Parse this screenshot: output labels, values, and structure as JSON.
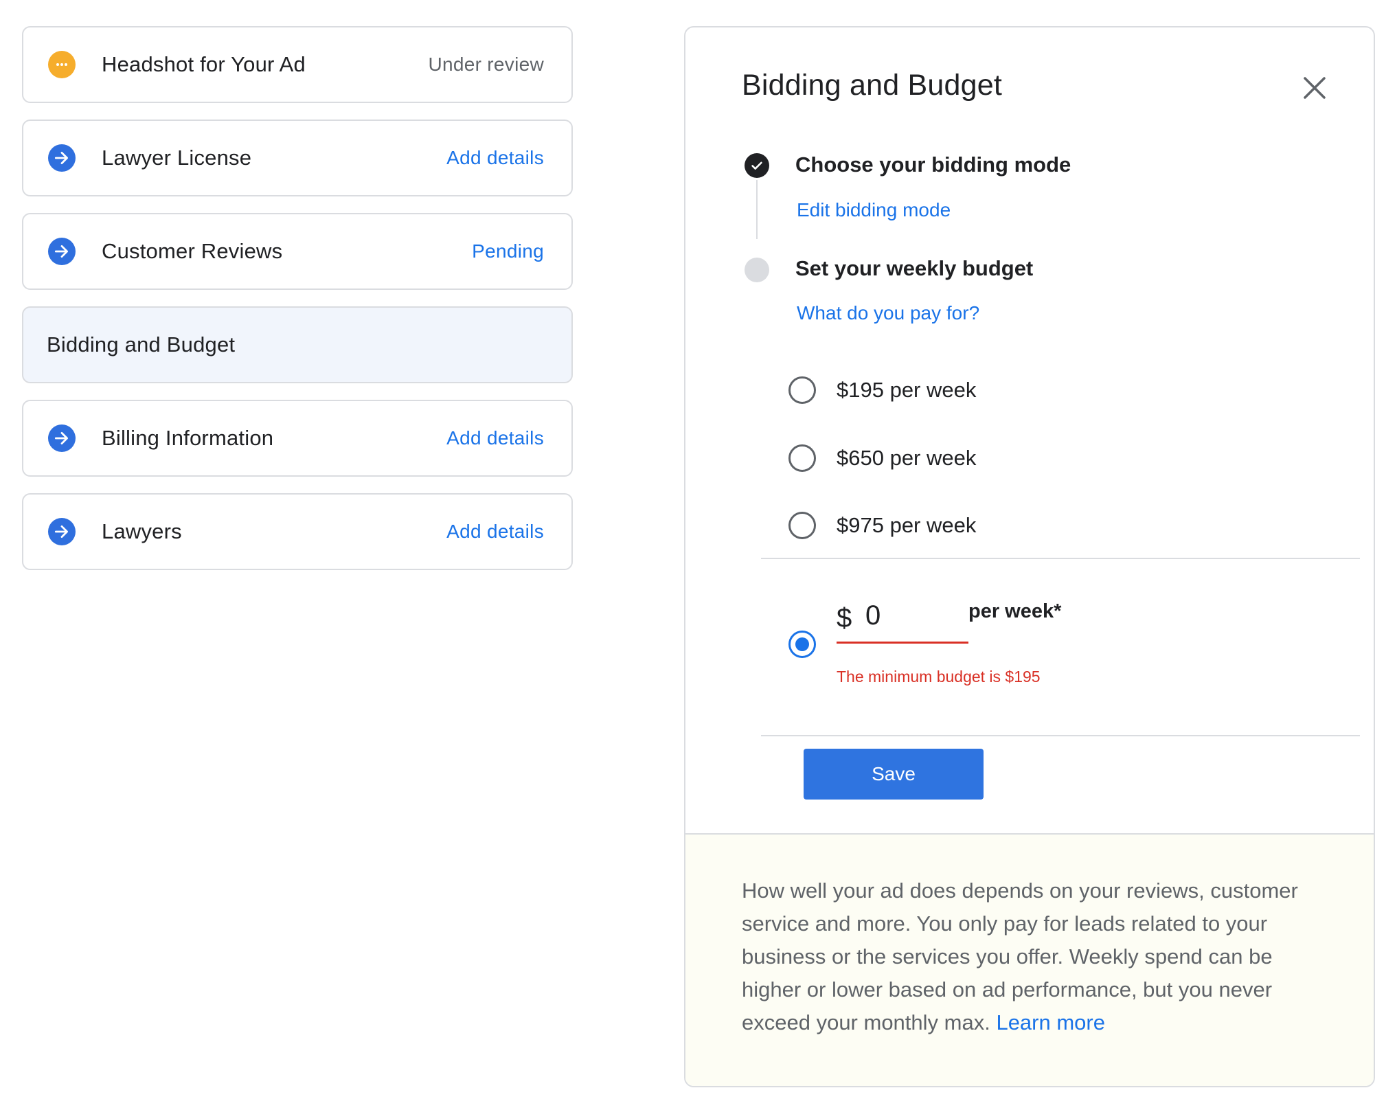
{
  "steps": [
    {
      "title": "Headshot for Your Ad",
      "status": "Under review",
      "icon": "pending-icon",
      "status_color": "#5f6368"
    },
    {
      "title": "Lawyer License",
      "status": "Add details",
      "icon": "arrow-right-icon",
      "status_color": "#1a73e8"
    },
    {
      "title": "Customer Reviews",
      "status": "Pending",
      "icon": "arrow-right-icon",
      "status_color": "#1a73e8"
    },
    {
      "title": "Bidding and Budget",
      "status": "",
      "icon": "",
      "active": true
    },
    {
      "title": "Billing Information",
      "status": "Add details",
      "icon": "arrow-right-icon",
      "status_color": "#1a73e8"
    },
    {
      "title": "Lawyers",
      "status": "Add details",
      "icon": "arrow-right-icon",
      "status_color": "#1a73e8"
    }
  ],
  "panel": {
    "title": "Bidding and Budget",
    "close_icon": "close-icon",
    "bidding_step": {
      "heading": "Choose your bidding mode",
      "link": "Edit bidding mode",
      "state": "complete"
    },
    "budget_step": {
      "heading": "Set your weekly budget",
      "link": "What do you pay for?",
      "state": "current"
    },
    "options": [
      {
        "label": "$195 per week",
        "selected": false
      },
      {
        "label": "$650 per week",
        "selected": false
      },
      {
        "label": "$975 per week",
        "selected": false
      }
    ],
    "custom": {
      "selected": true,
      "currency": "$",
      "value": "0",
      "suffix": "per week*",
      "error": "The minimum budget is $195"
    },
    "save_label": "Save",
    "info": {
      "text": "How well your ad does depends on your reviews, customer service and more. You only pay for leads related to your business or the services you offer. Weekly spend can be higher or lower based on ad performance, but you never exceed your monthly max.",
      "link": "Learn more"
    }
  },
  "colors": {
    "accent": "#1a73e8",
    "button": "#2f74e0",
    "error": "#d93025",
    "pending": "#f6ad2c",
    "active_row": "#f1f5fc",
    "info_bg": "#fdfdf4"
  }
}
